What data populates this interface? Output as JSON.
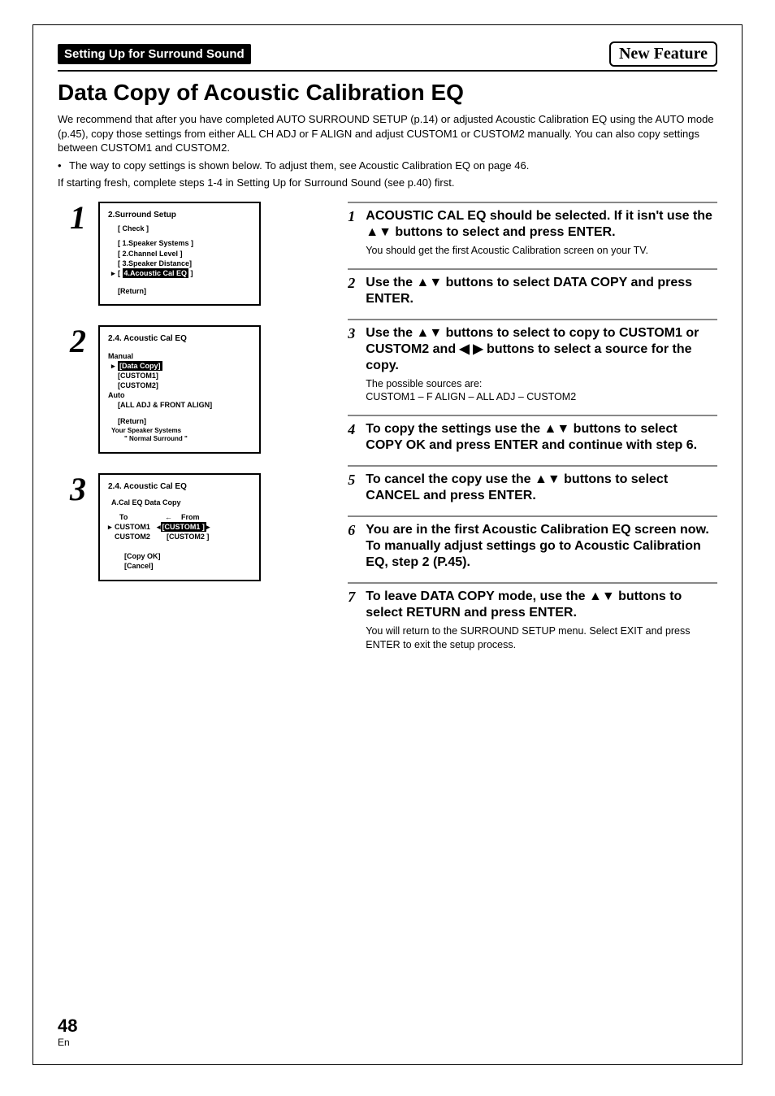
{
  "header": {
    "section": "Setting Up for Surround Sound",
    "new_feature": "New Feature"
  },
  "title": "Data Copy of Acoustic Calibration EQ",
  "intro1": "We recommend that after you have completed AUTO SURROUND SETUP (p.14) or adjusted Acoustic Calibration EQ using the AUTO mode (p.45), copy those settings from either ALL CH ADJ or F ALIGN and adjust CUSTOM1 or CUSTOM2 manually. You can also copy settings between CUSTOM1 and CUSTOM2.",
  "intro_bullet": "The way to copy settings is shown below. To adjust them, see Acoustic Calibration EQ on page 46.",
  "intro2": "If starting fresh, complete steps 1-4 in Setting Up for Surround Sound (see p.40) first.",
  "left_steps": {
    "s1_num": "1",
    "s2_num": "2",
    "s3_num": "3"
  },
  "osd1": {
    "title": "2.Surround Setup",
    "check": "[ Check ]",
    "i1": "[ 1.Speaker Systems ]",
    "i2": "[ 2.Channel Level ]",
    "i3": "[ 3.Speaker Distance]",
    "i4_pre": "[ ",
    "i4_sel": "4.Acoustic Cal EQ",
    "i4_post": " ]",
    "ret": "[Return]"
  },
  "osd2": {
    "title": "2.4. Acoustic  Cal  EQ",
    "manual": "Manual",
    "dc": "[Data Copy]",
    "c1": "[CUSTOM1]",
    "c2": "[CUSTOM2]",
    "auto": "Auto",
    "al": "[ALL ADJ & FRONT ALIGN]",
    "ret": "[Return]",
    "foot1": "Your  Speaker  Systems",
    "foot2": "\" Normal  Surround \""
  },
  "osd3": {
    "title": "2.4. Acoustic  Cal  EQ",
    "sub": "A.Cal EQ Data Copy",
    "to": "To",
    "arrow": "←",
    "from": "From",
    "r1a": "CUSTOM1",
    "r1b": "[CUSTOM1 ]",
    "r2a": "CUSTOM2",
    "r2b": "[CUSTOM2 ]",
    "ok": "[Copy OK]",
    "cancel": "[Cancel]"
  },
  "right_steps": [
    {
      "num": "1",
      "head": "ACOUSTIC CAL EQ should be selected. If it isn't use the ▲▼ buttons to select  and press ENTER.",
      "body": "You should get the first Acoustic Calibration screen on your TV."
    },
    {
      "num": "2",
      "head": "Use the ▲▼ buttons to select DATA COPY and press ENTER.",
      "body": ""
    },
    {
      "num": "3",
      "head": "Use the ▲▼ buttons to select to copy to CUSTOM1 or CUSTOM2 and ◀ ▶ buttons to select a source for the copy.",
      "body": "The possible sources are:\nCUSTOM1 – F ALIGN – ALL ADJ – CUSTOM2"
    },
    {
      "num": "4",
      "head": "To copy the settings use the ▲▼ buttons to select COPY OK and press ENTER and continue with step 6.",
      "body": ""
    },
    {
      "num": "5",
      "head": "To cancel the copy use the ▲▼ buttons to select CANCEL and press ENTER.",
      "body": ""
    },
    {
      "num": "6",
      "head": "You are in the first Acoustic Calibration EQ screen now. To manually adjust settings go to Acoustic Calibration EQ, step 2 (P.45).",
      "body": ""
    },
    {
      "num": "7",
      "head": "To leave DATA COPY mode, use the ▲▼ buttons to select RETURN and press ENTER.",
      "body": "You will return to the SURROUND SETUP menu. Select EXIT and press ENTER to exit the setup process."
    }
  ],
  "page_num": "48",
  "page_lang": "En"
}
